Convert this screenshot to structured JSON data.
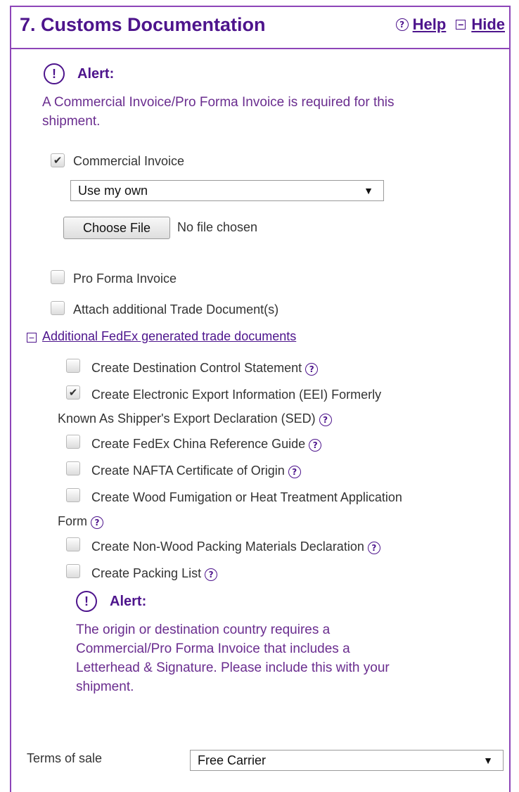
{
  "header": {
    "title": "7. Customs Documentation",
    "help_label": "Help",
    "hide_label": "Hide"
  },
  "alert1": {
    "label": "Alert:",
    "text_line1": "A Commercial Invoice/Pro Forma Invoice is required for this",
    "text_line2": "shipment."
  },
  "commercial_invoice": {
    "label": "Commercial Invoice",
    "checked": true,
    "select_value": "Use my own",
    "choose_file_label": "Choose File",
    "file_status": "No file chosen"
  },
  "pro_forma": {
    "label": "Pro Forma Invoice",
    "checked": false
  },
  "attach_trade": {
    "label": "Attach additional Trade Document(s)",
    "checked": false
  },
  "additional_docs": {
    "toggle_label": "Additional FedEx generated trade documents",
    "items": [
      {
        "line1": "Create Destination Control Statement",
        "checked": false
      },
      {
        "line1": "Create Electronic Export Information (EEI) Formerly",
        "line2": "Known As Shipper's Export Declaration (SED)",
        "checked": true
      },
      {
        "line1": "Create FedEx China Reference Guide",
        "checked": false
      },
      {
        "line1": "Create NAFTA Certificate of Origin",
        "checked": false
      },
      {
        "line1": "Create Wood Fumigation or Heat Treatment Application",
        "line2": "Form",
        "checked": false
      },
      {
        "line1": "Create Non-Wood Packing Materials Declaration",
        "checked": false
      },
      {
        "line1": "Create Packing List",
        "checked": false
      }
    ]
  },
  "alert2": {
    "label": "Alert:",
    "text_line1": "The origin or destination country requires a",
    "text_line2": "Commercial/Pro Forma Invoice that includes a",
    "text_line3": "Letterhead & Signature. Please include this with your",
    "text_line4": "shipment."
  },
  "terms_of_sale": {
    "label": "Terms of sale",
    "value": "Free Carrier"
  },
  "colors": {
    "accent": "#4d148c",
    "border": "#8d45b8"
  }
}
